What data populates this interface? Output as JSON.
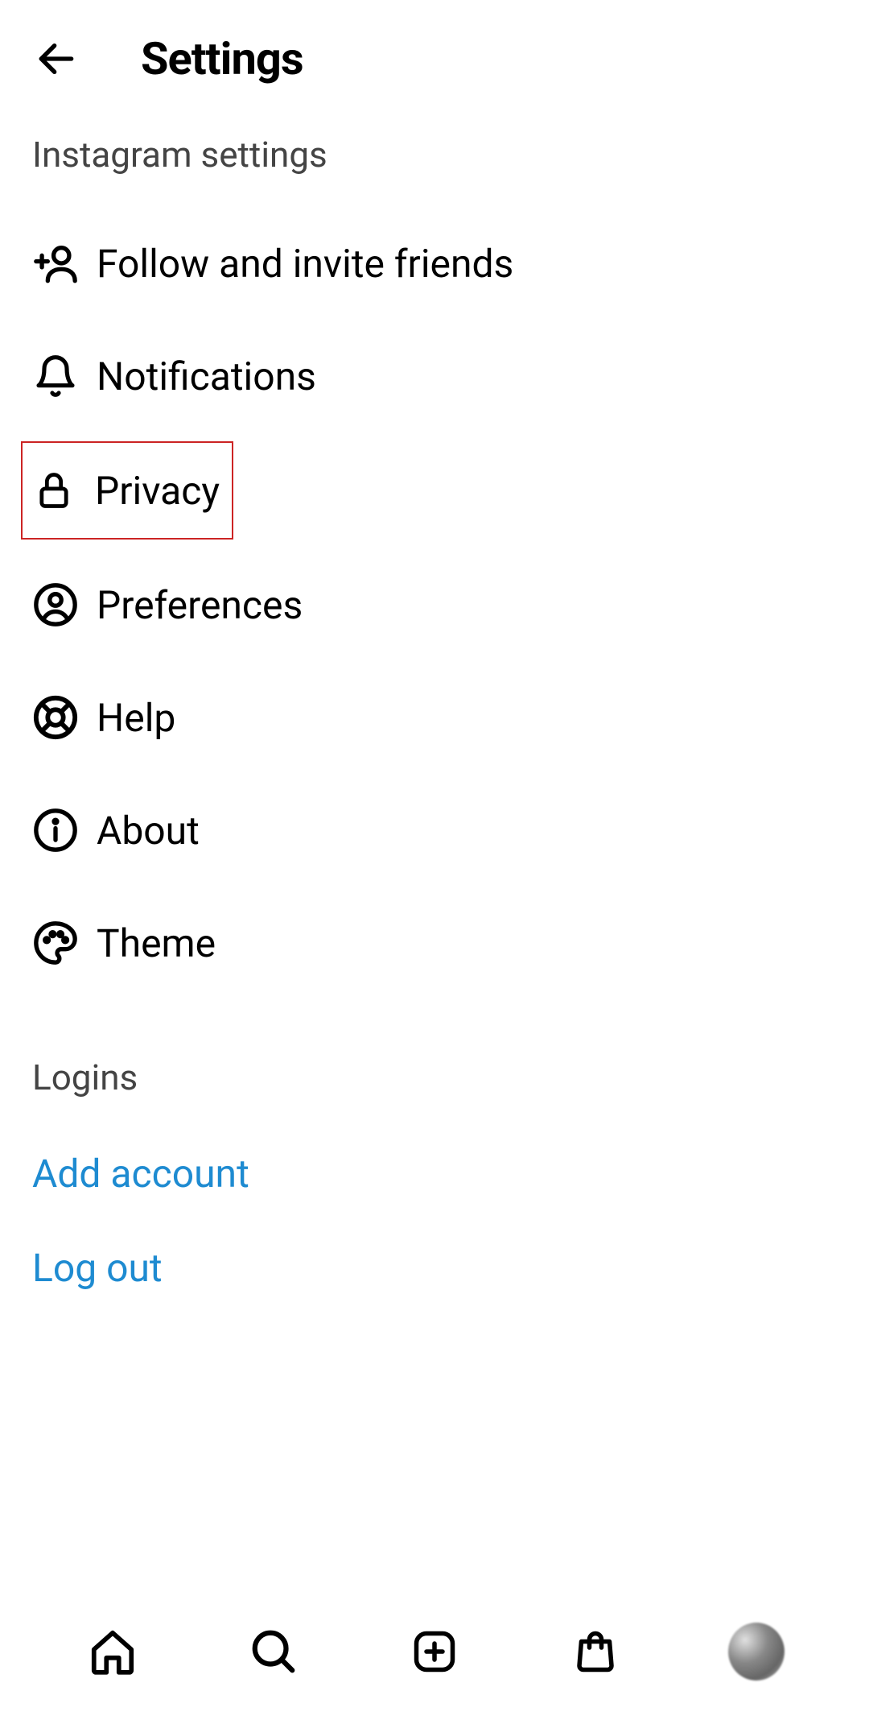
{
  "header": {
    "title": "Settings"
  },
  "section1": {
    "title": "Instagram settings"
  },
  "menu": [
    {
      "label": "Follow and invite friends",
      "icon": "add-user-icon",
      "highlighted": false
    },
    {
      "label": "Notifications",
      "icon": "bell-icon",
      "highlighted": false
    },
    {
      "label": "Privacy",
      "icon": "lock-icon",
      "highlighted": true
    },
    {
      "label": "Preferences",
      "icon": "person-circle-icon",
      "highlighted": false
    },
    {
      "label": "Help",
      "icon": "lifebuoy-icon",
      "highlighted": false
    },
    {
      "label": "About",
      "icon": "info-icon",
      "highlighted": false
    },
    {
      "label": "Theme",
      "icon": "palette-icon",
      "highlighted": false
    }
  ],
  "loginsSection": {
    "title": "Logins",
    "actions": [
      {
        "label": "Add account"
      },
      {
        "label": "Log out"
      }
    ]
  },
  "bottomNav": [
    {
      "icon": "home-icon"
    },
    {
      "icon": "search-icon"
    },
    {
      "icon": "add-post-icon"
    },
    {
      "icon": "shop-icon"
    },
    {
      "icon": "avatar"
    }
  ]
}
